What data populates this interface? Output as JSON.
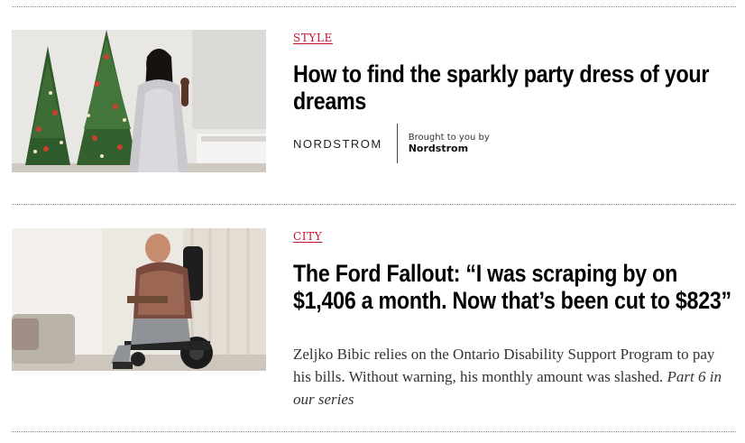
{
  "articles": [
    {
      "kicker": "STYLE",
      "headline": "How to find the sparkly party dress of your dreams",
      "image_alt": "Woman in a sparkly silver dress beside decorated Christmas trees",
      "sponsor": {
        "logo_text": "NORDSTROM",
        "brought_by": "Brought to you by",
        "name": "Nordstrom"
      }
    },
    {
      "kicker": "CITY",
      "headline": "The Ford Fallout: “I was scraping by on $1,406 a month. Now that’s been cut to $823”",
      "image_alt": "Man in a power wheelchair in a bright living room",
      "dek": "Zeljko Bibic relies on the Ontario Disability Support Program to pay his bills. Without warning, his monthly amount was slashed.",
      "dek_series": "Part 6 in our series"
    }
  ]
}
